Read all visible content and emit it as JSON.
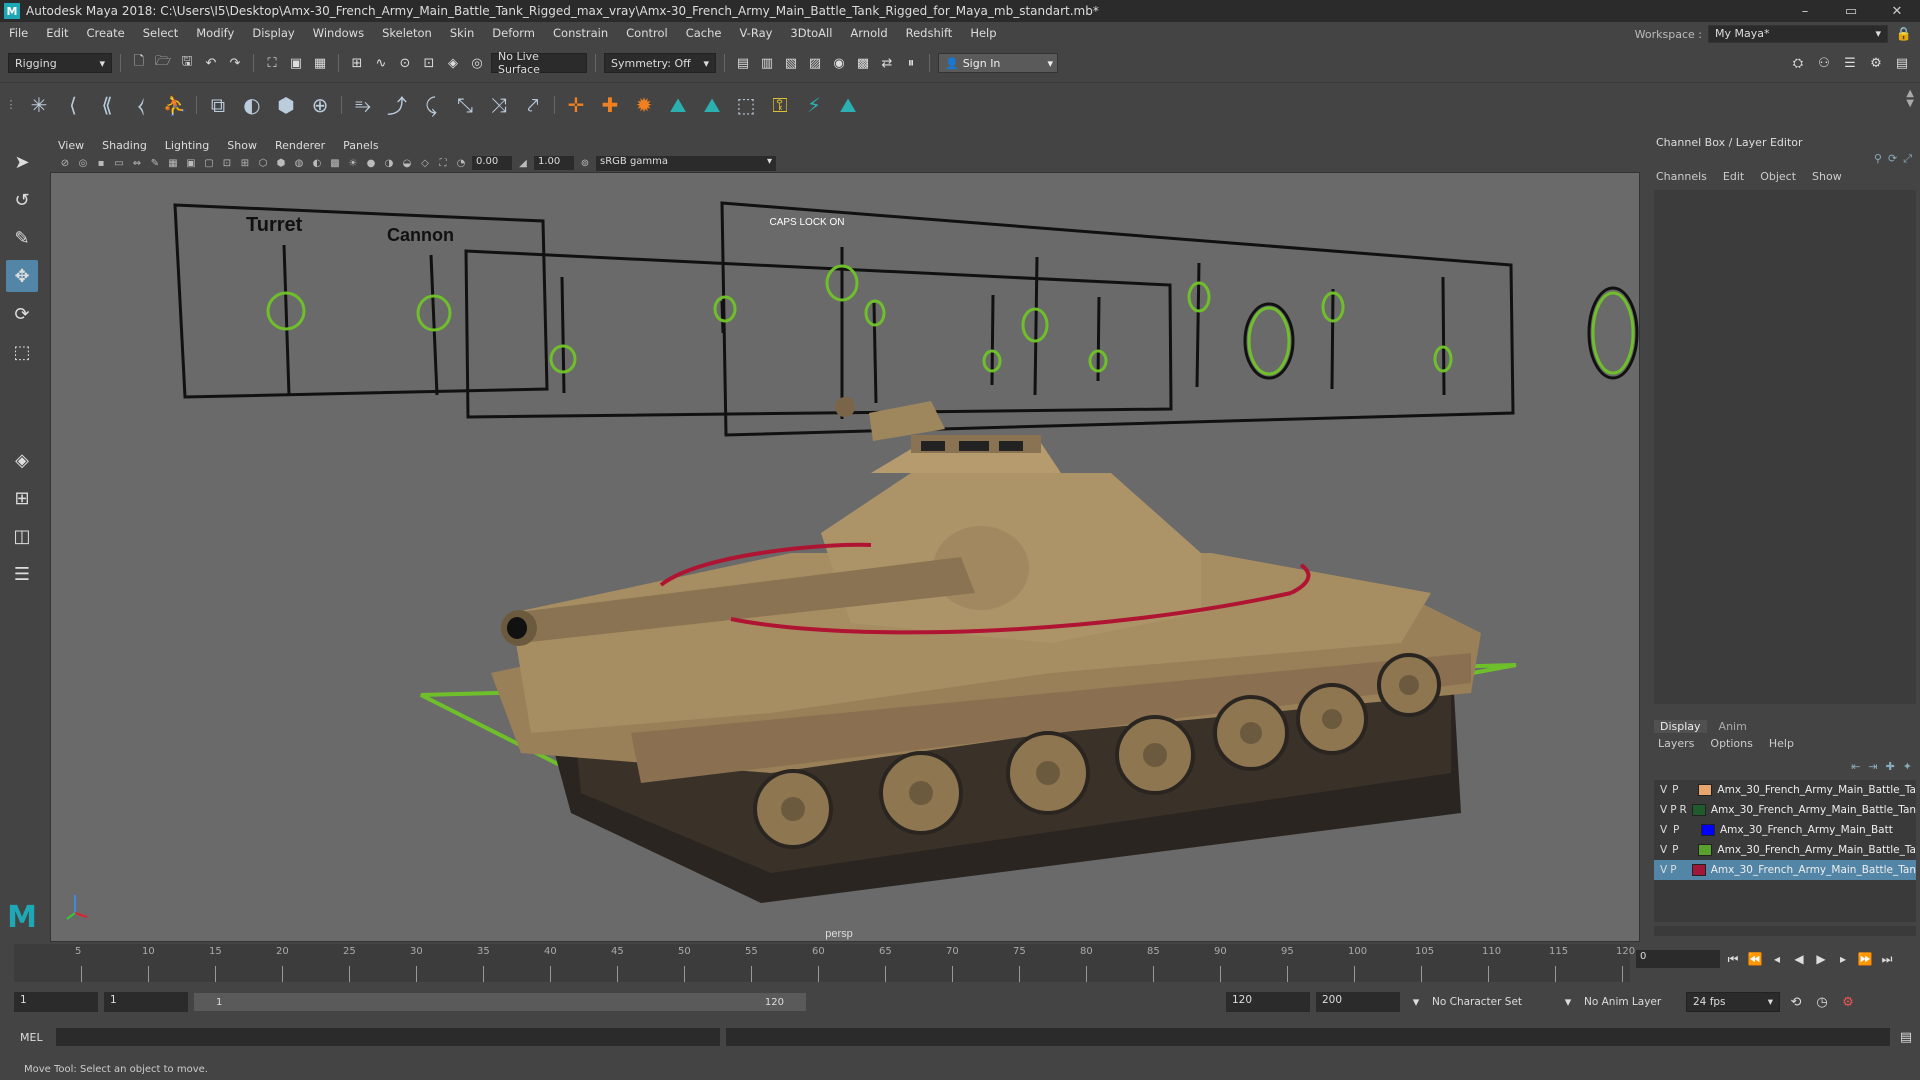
{
  "window": {
    "title": "Autodesk Maya 2018: C:\\Users\\I5\\Desktop\\Amx-30_French_Army_Main_Battle_Tank_Rigged_max_vray\\Amx-30_French_Army_Main_Battle_Tank_Rigged_for_Maya_mb_standart.mb*",
    "controls": [
      "–",
      "▭",
      "✕"
    ]
  },
  "menu": [
    "File",
    "Edit",
    "Create",
    "Select",
    "Modify",
    "Display",
    "Windows",
    "Skeleton",
    "Skin",
    "Deform",
    "Constrain",
    "Control",
    "Cache",
    "V-Ray",
    "3DtoAll",
    "Arnold",
    "Redshift",
    "Help"
  ],
  "workspace": {
    "label": "Workspace :",
    "value": "My Maya*"
  },
  "statusline": {
    "menuset": "Rigging",
    "live_surface": "No Live Surface",
    "symmetry": "Symmetry: Off",
    "sign_in": "Sign In"
  },
  "viewport": {
    "menu": [
      "View",
      "Shading",
      "Lighting",
      "Show",
      "Renderer",
      "Panels"
    ],
    "exposure": "0.00",
    "gamma": "1.00",
    "color_space": "sRGB gamma",
    "caps_lock": "CAPS LOCK ON",
    "label_turret": "Turret",
    "label_cannon": "Cannon",
    "camera": "persp"
  },
  "channel_box": {
    "title": "Channel Box / Layer Editor",
    "tabs": [
      "Channels",
      "Edit",
      "Object",
      "Show"
    ]
  },
  "layer_editor": {
    "tabs": [
      "Display",
      "Anim"
    ],
    "menus": [
      "Layers",
      "Options",
      "Help"
    ],
    "layers": [
      {
        "v": "V",
        "p": "P",
        "r": "",
        "color": "#e8a66f",
        "name": "Amx_30_French_Army_Main_Battle_Ta"
      },
      {
        "v": "V",
        "p": "P",
        "r": "R",
        "color": "#1f5b2d",
        "name": "Amx_30_French_Army_Main_Battle_Tanl"
      },
      {
        "v": "V",
        "p": "P",
        "r": "",
        "color": "#0000ff",
        "name": "Amx_30_French_Army_Main_Batt"
      },
      {
        "v": "V",
        "p": "P",
        "r": "",
        "color": "#5aa02c",
        "name": "Amx_30_French_Army_Main_Battle_Ta"
      },
      {
        "v": "V",
        "p": "P",
        "r": "",
        "color": "#a0173a",
        "name": "Amx_30_French_Army_Main_Battle_Tan",
        "selected": true
      }
    ]
  },
  "timeline": {
    "ticks": [
      "5",
      "10",
      "15",
      "20",
      "25",
      "30",
      "35",
      "40",
      "45",
      "50",
      "55",
      "60",
      "65",
      "70",
      "75",
      "80",
      "85",
      "90",
      "95",
      "100",
      "105",
      "110",
      "115",
      "120"
    ],
    "current_frame": "0"
  },
  "range": {
    "start": "1",
    "playback_start": "1",
    "slider_start": "1",
    "slider_end": "120",
    "playback_end": "120",
    "end": "200",
    "character_set": "No Character Set",
    "anim_layer": "No Anim Layer",
    "fps": "24 fps"
  },
  "command_line": {
    "label": "MEL"
  },
  "help_line": "Move Tool: Select an object to move."
}
